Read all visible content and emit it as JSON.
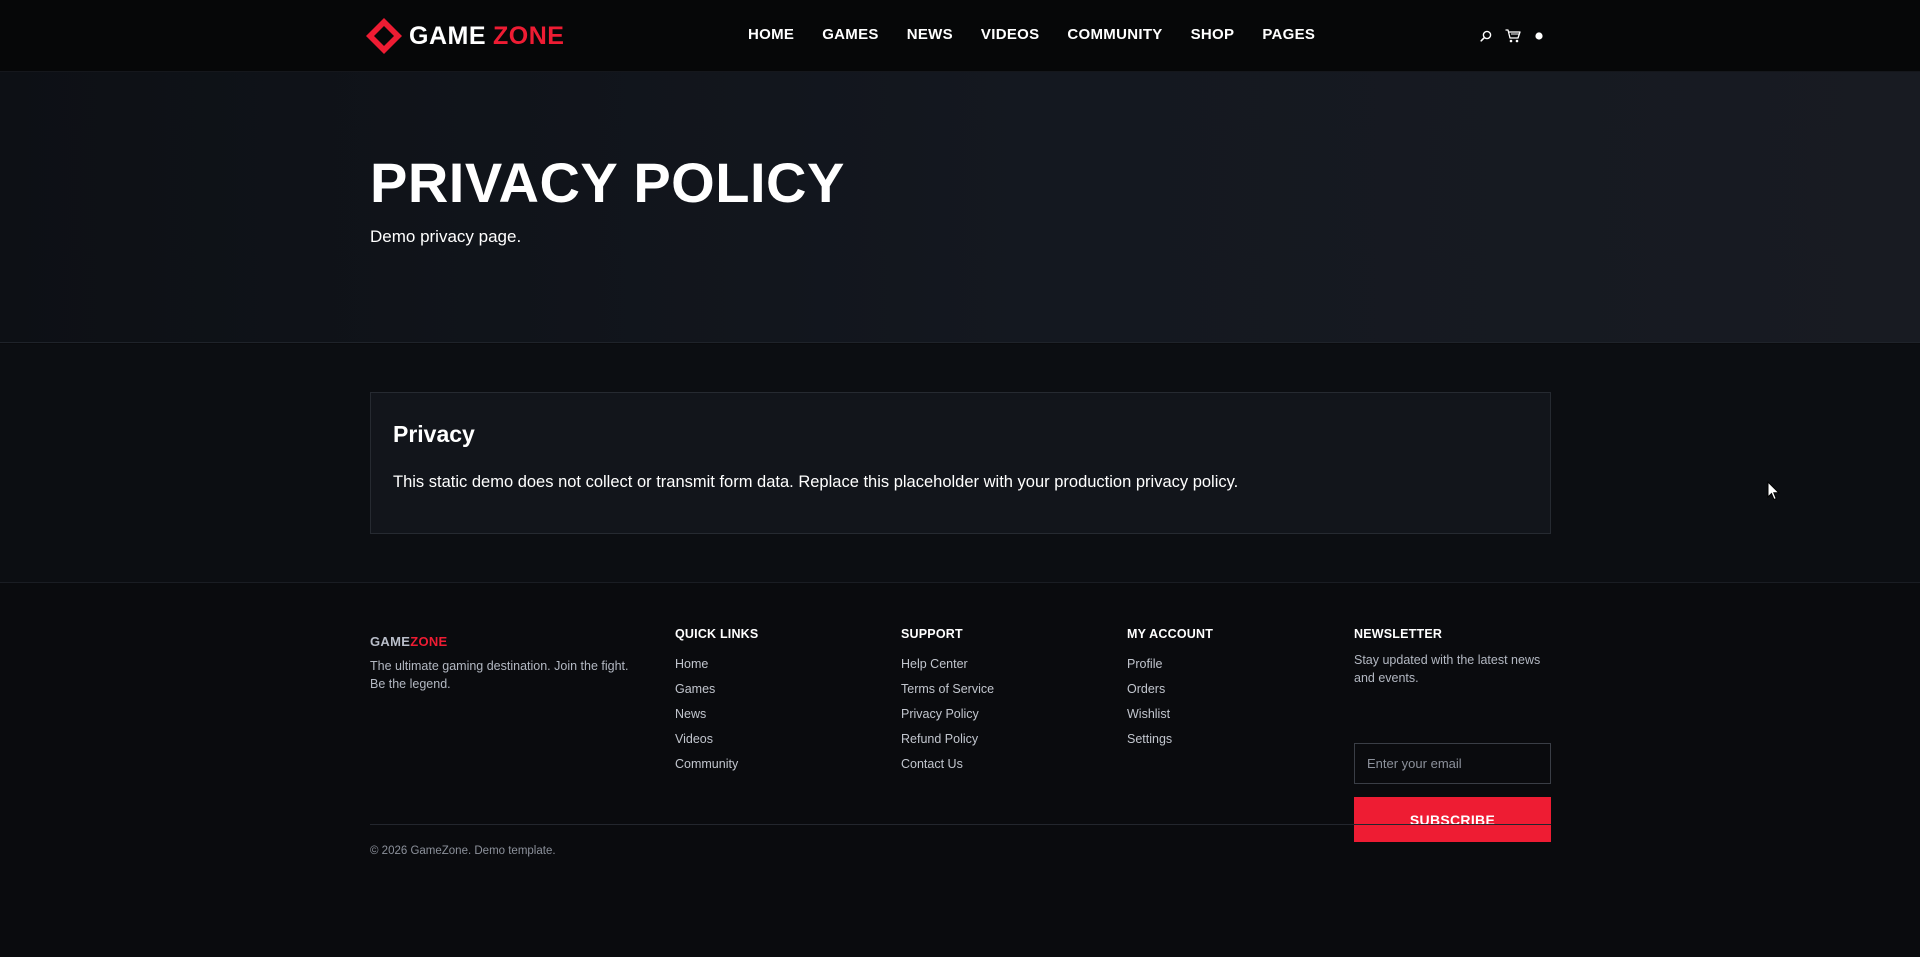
{
  "colors": {
    "accent": "#ee1c33",
    "background": "#0a0b0e",
    "header_bg": "#060708",
    "card_bg": "#12151b"
  },
  "header": {
    "logo_word1": "GAME",
    "logo_word2": "ZONE",
    "logo_icon": "diamond-logo-icon",
    "nav": [
      "HOME",
      "GAMES",
      "NEWS",
      "VIDEOS",
      "COMMUNITY",
      "SHOP",
      "PAGES"
    ],
    "icons": [
      "search-icon",
      "cart-icon",
      "user-icon"
    ]
  },
  "hero": {
    "title": "PRIVACY POLICY",
    "subtitle": "Demo privacy page."
  },
  "content": {
    "card_title": "Privacy",
    "card_text": "This static demo does not collect or transmit form data. Replace this placeholder with your production privacy policy."
  },
  "footer": {
    "brand_word1": "GAME",
    "brand_word2": "ZONE",
    "description": "The ultimate gaming destination. Join the fight. Be the legend.",
    "quick_links": {
      "heading": "QUICK LINKS",
      "items": [
        "Home",
        "Games",
        "News",
        "Videos",
        "Community"
      ]
    },
    "support": {
      "heading": "SUPPORT",
      "items": [
        "Help Center",
        "Terms of Service",
        "Privacy Policy",
        "Refund Policy",
        "Contact Us"
      ]
    },
    "account": {
      "heading": "MY ACCOUNT",
      "items": [
        "Profile",
        "Orders",
        "Wishlist",
        "Settings"
      ]
    },
    "newsletter": {
      "heading": "NEWSLETTER",
      "description": "Stay updated with the latest news and events.",
      "placeholder": "Enter your email",
      "button": "SUBSCRIBE"
    },
    "copyright": "© 2026 GameZone. Demo template."
  }
}
